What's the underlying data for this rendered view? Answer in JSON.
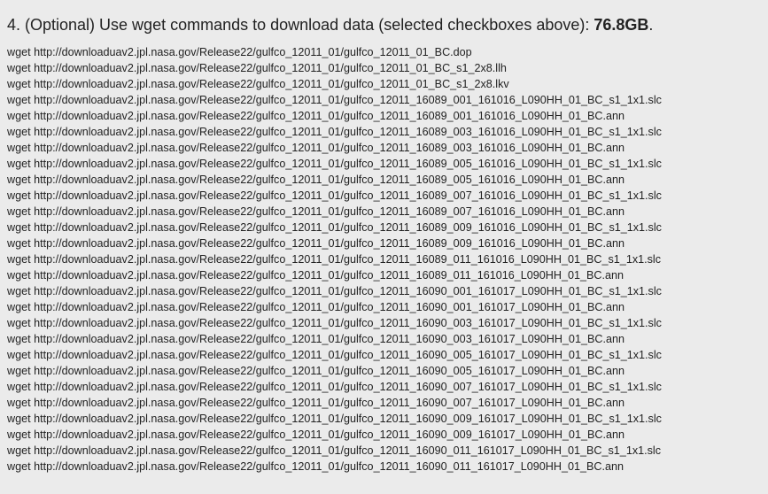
{
  "section": {
    "heading_prefix": "4. (Optional) Use wget commands to download data (selected checkboxes above): ",
    "total_size": "76.8GB",
    "heading_suffix": "."
  },
  "commands": [
    "wget http://downloaduav2.jpl.nasa.gov/Release22/gulfco_12011_01/gulfco_12011_01_BC.dop",
    "wget http://downloaduav2.jpl.nasa.gov/Release22/gulfco_12011_01/gulfco_12011_01_BC_s1_2x8.llh",
    "wget http://downloaduav2.jpl.nasa.gov/Release22/gulfco_12011_01/gulfco_12011_01_BC_s1_2x8.lkv",
    "wget http://downloaduav2.jpl.nasa.gov/Release22/gulfco_12011_01/gulfco_12011_16089_001_161016_L090HH_01_BC_s1_1x1.slc",
    "wget http://downloaduav2.jpl.nasa.gov/Release22/gulfco_12011_01/gulfco_12011_16089_001_161016_L090HH_01_BC.ann",
    "wget http://downloaduav2.jpl.nasa.gov/Release22/gulfco_12011_01/gulfco_12011_16089_003_161016_L090HH_01_BC_s1_1x1.slc",
    "wget http://downloaduav2.jpl.nasa.gov/Release22/gulfco_12011_01/gulfco_12011_16089_003_161016_L090HH_01_BC.ann",
    "wget http://downloaduav2.jpl.nasa.gov/Release22/gulfco_12011_01/gulfco_12011_16089_005_161016_L090HH_01_BC_s1_1x1.slc",
    "wget http://downloaduav2.jpl.nasa.gov/Release22/gulfco_12011_01/gulfco_12011_16089_005_161016_L090HH_01_BC.ann",
    "wget http://downloaduav2.jpl.nasa.gov/Release22/gulfco_12011_01/gulfco_12011_16089_007_161016_L090HH_01_BC_s1_1x1.slc",
    "wget http://downloaduav2.jpl.nasa.gov/Release22/gulfco_12011_01/gulfco_12011_16089_007_161016_L090HH_01_BC.ann",
    "wget http://downloaduav2.jpl.nasa.gov/Release22/gulfco_12011_01/gulfco_12011_16089_009_161016_L090HH_01_BC_s1_1x1.slc",
    "wget http://downloaduav2.jpl.nasa.gov/Release22/gulfco_12011_01/gulfco_12011_16089_009_161016_L090HH_01_BC.ann",
    "wget http://downloaduav2.jpl.nasa.gov/Release22/gulfco_12011_01/gulfco_12011_16089_011_161016_L090HH_01_BC_s1_1x1.slc",
    "wget http://downloaduav2.jpl.nasa.gov/Release22/gulfco_12011_01/gulfco_12011_16089_011_161016_L090HH_01_BC.ann",
    "wget http://downloaduav2.jpl.nasa.gov/Release22/gulfco_12011_01/gulfco_12011_16090_001_161017_L090HH_01_BC_s1_1x1.slc",
    "wget http://downloaduav2.jpl.nasa.gov/Release22/gulfco_12011_01/gulfco_12011_16090_001_161017_L090HH_01_BC.ann",
    "wget http://downloaduav2.jpl.nasa.gov/Release22/gulfco_12011_01/gulfco_12011_16090_003_161017_L090HH_01_BC_s1_1x1.slc",
    "wget http://downloaduav2.jpl.nasa.gov/Release22/gulfco_12011_01/gulfco_12011_16090_003_161017_L090HH_01_BC.ann",
    "wget http://downloaduav2.jpl.nasa.gov/Release22/gulfco_12011_01/gulfco_12011_16090_005_161017_L090HH_01_BC_s1_1x1.slc",
    "wget http://downloaduav2.jpl.nasa.gov/Release22/gulfco_12011_01/gulfco_12011_16090_005_161017_L090HH_01_BC.ann",
    "wget http://downloaduav2.jpl.nasa.gov/Release22/gulfco_12011_01/gulfco_12011_16090_007_161017_L090HH_01_BC_s1_1x1.slc",
    "wget http://downloaduav2.jpl.nasa.gov/Release22/gulfco_12011_01/gulfco_12011_16090_007_161017_L090HH_01_BC.ann",
    "wget http://downloaduav2.jpl.nasa.gov/Release22/gulfco_12011_01/gulfco_12011_16090_009_161017_L090HH_01_BC_s1_1x1.slc",
    "wget http://downloaduav2.jpl.nasa.gov/Release22/gulfco_12011_01/gulfco_12011_16090_009_161017_L090HH_01_BC.ann",
    "wget http://downloaduav2.jpl.nasa.gov/Release22/gulfco_12011_01/gulfco_12011_16090_011_161017_L090HH_01_BC_s1_1x1.slc",
    "wget http://downloaduav2.jpl.nasa.gov/Release22/gulfco_12011_01/gulfco_12011_16090_011_161017_L090HH_01_BC.ann"
  ],
  "colors": {
    "background": "#ebebeb",
    "text": "#222222"
  }
}
